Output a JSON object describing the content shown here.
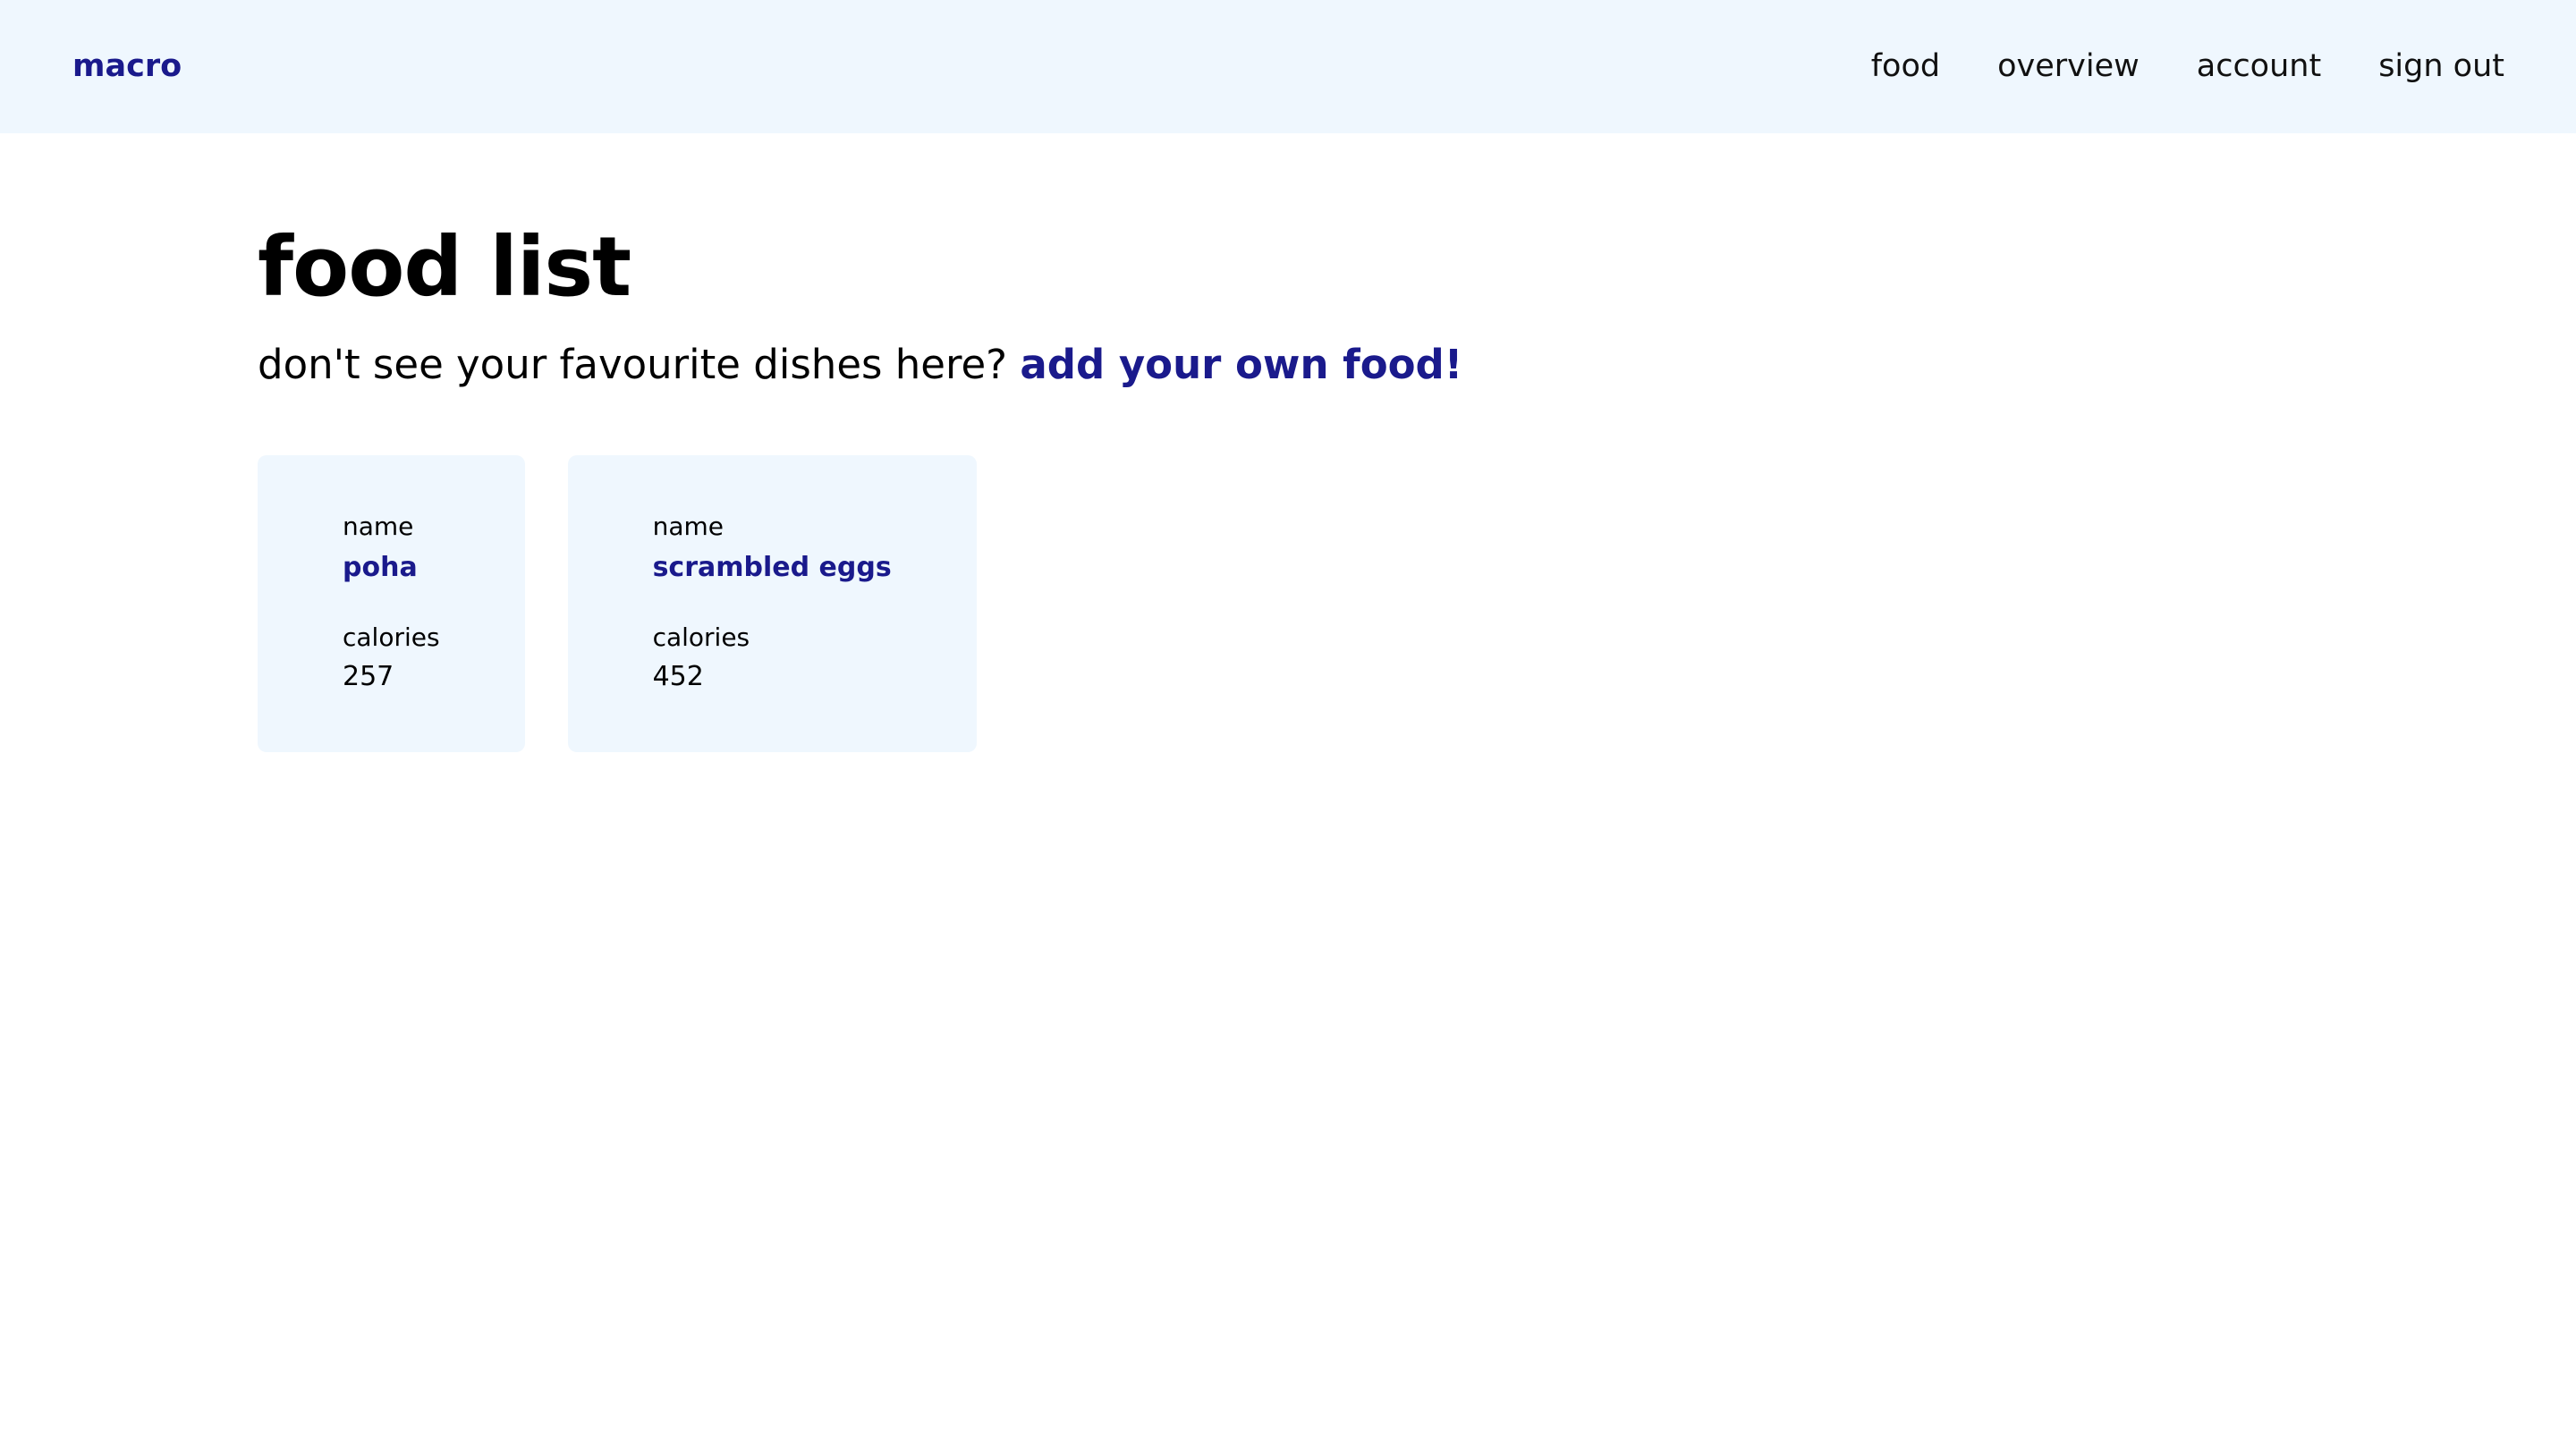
{
  "nav": {
    "brand": "macro",
    "links": [
      {
        "label": "food"
      },
      {
        "label": "overview"
      },
      {
        "label": "account"
      },
      {
        "label": "sign out"
      }
    ]
  },
  "page": {
    "title": "food list",
    "subtitle_text": "don't see your favourite dishes here?",
    "add_link": "add your own food!"
  },
  "foods": [
    {
      "name_label": "name",
      "name": "poha",
      "calories_label": "calories",
      "calories": "257"
    },
    {
      "name_label": "name",
      "name": "scrambled eggs",
      "calories_label": "calories",
      "calories": "452"
    }
  ],
  "colors": {
    "accent": "#1a1a8c",
    "nav_background": "#eff7fe",
    "card_background": "#eff7fe"
  }
}
